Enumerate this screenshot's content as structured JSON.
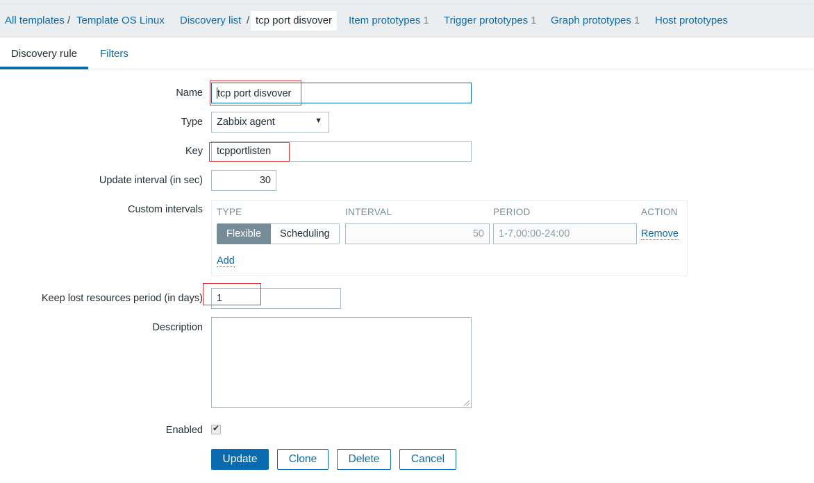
{
  "breadcrumb": {
    "all_templates": "All templates",
    "sep1": "/",
    "template": "Template OS Linux",
    "discovery_list": "Discovery list",
    "sep2": "/",
    "current": "tcp port disvover",
    "item_prototypes": {
      "label": "Item prototypes",
      "count": "1"
    },
    "trigger_prototypes": {
      "label": "Trigger prototypes",
      "count": "1"
    },
    "graph_prototypes": {
      "label": "Graph prototypes",
      "count": "1"
    },
    "host_prototypes": {
      "label": "Host prototypes"
    }
  },
  "tabs": [
    {
      "label": "Discovery rule",
      "active": true
    },
    {
      "label": "Filters",
      "active": false
    }
  ],
  "form": {
    "name": {
      "label": "Name",
      "value": "tcp port disvover"
    },
    "type": {
      "label": "Type",
      "value": "Zabbix agent"
    },
    "key": {
      "label": "Key",
      "value": "tcpportlisten"
    },
    "update_interval": {
      "label": "Update interval (in sec)",
      "value": "30"
    },
    "custom_intervals": {
      "label": "Custom intervals",
      "headers": {
        "type": "TYPE",
        "interval": "INTERVAL",
        "period": "PERIOD",
        "action": "ACTION"
      },
      "rows": [
        {
          "type_options": [
            "Flexible",
            "Scheduling"
          ],
          "selected_type": "Flexible",
          "interval": "50",
          "period": "1-7,00:00-24:00",
          "action": "Remove"
        }
      ],
      "add_label": "Add"
    },
    "keep_lost": {
      "label": "Keep lost resources period (in days)",
      "value": "1"
    },
    "description": {
      "label": "Description",
      "value": ""
    },
    "enabled": {
      "label": "Enabled",
      "checked": true
    }
  },
  "buttons": {
    "update": "Update",
    "clone": "Clone",
    "delete": "Delete",
    "cancel": "Cancel"
  },
  "colors": {
    "link": "#0a6ab0",
    "primary_button": "#0a6ab0",
    "highlight_annotation": "#e0393e",
    "segment_active": "#768d99"
  }
}
